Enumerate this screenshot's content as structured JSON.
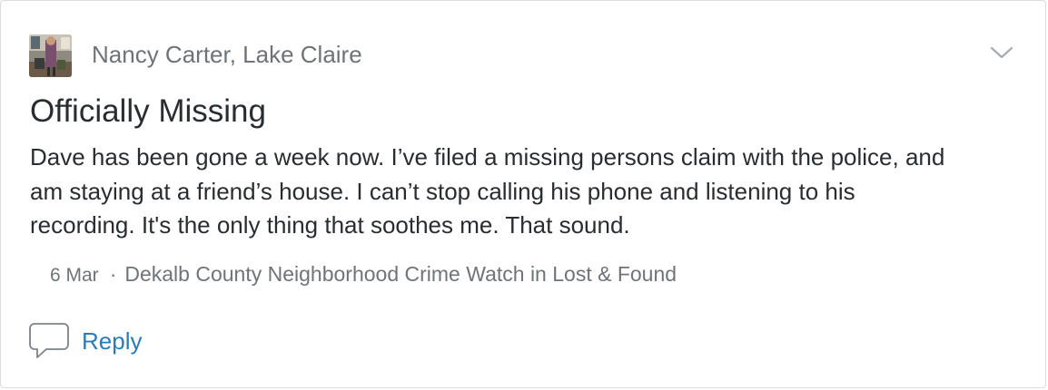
{
  "post": {
    "author": "Nancy Carter, Lake Claire",
    "title": "Officially Missing",
    "body": "Dave has been gone a week now. I’ve filed a missing persons claim with the police, and am staying at a friend’s house. I can’t stop calling his phone and listening to his recording. It's the only thing that soothes me. That sound.",
    "date": "6 Mar",
    "separator": "·",
    "location": "Dekalb County Neighborhood Crime Watch in Lost & Found"
  },
  "actions": {
    "reply_label": "Reply"
  },
  "icons": {
    "menu": "chevron-down-icon",
    "reply": "speech-bubble-icon"
  },
  "colors": {
    "text_primary": "#2a2d30",
    "text_secondary": "#707478",
    "link": "#2a7cb8",
    "border": "#dcdcdc"
  }
}
